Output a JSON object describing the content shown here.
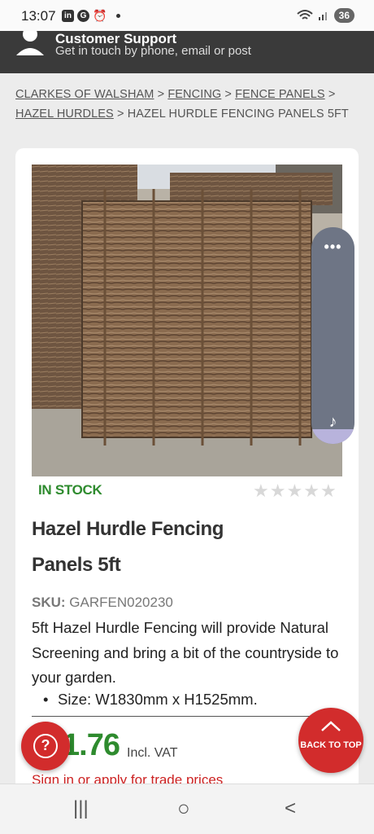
{
  "status_bar": {
    "time": "13:07",
    "battery": "36",
    "icons": [
      "linkedin-icon",
      "google-icon",
      "alarm-icon",
      "dot-icon",
      "wifi-icon",
      "signal-icon"
    ]
  },
  "support": {
    "title": "Customer Support",
    "subtitle": "Get in touch by phone, email or post"
  },
  "breadcrumb": {
    "items": [
      {
        "label": "CLARKES OF WALSHAM",
        "link": true
      },
      {
        "label": "FENCING",
        "link": true
      },
      {
        "label": "FENCE PANELS",
        "link": true
      },
      {
        "label": "HAZEL HURDLES",
        "link": true
      },
      {
        "label": "HAZEL HURDLE FENCING PANELS 5FT",
        "link": false
      }
    ],
    "separator": ">"
  },
  "product": {
    "stock": "IN STOCK",
    "rating_stars": 0,
    "rating_max": 5,
    "title": "Hazel Hurdle Fencing Panels 5ft",
    "sku_label": "SKU:",
    "sku": "GARFEN020230",
    "description": "5ft Hazel Hurdle Fencing will provide Natural Screening and bring a bit of the countryside to your garden.",
    "bullet": "Size: W1830mm x H1525mm.",
    "price": "1.76",
    "price_suffix": "Incl. VAT",
    "trade_link": "Sign in or apply for trade prices"
  },
  "floating": {
    "help_icon": "?",
    "back_to_top": "BACK TO TOP",
    "side_menu_icon": "•••",
    "music_icon": "♪"
  },
  "nav": {
    "recents_icon": "|||",
    "home_icon": "○",
    "back_icon": "<"
  },
  "colors": {
    "accent_red": "#d22c2c",
    "stock_green": "#2e8b2e",
    "banner_dark": "#3a3a3a"
  }
}
